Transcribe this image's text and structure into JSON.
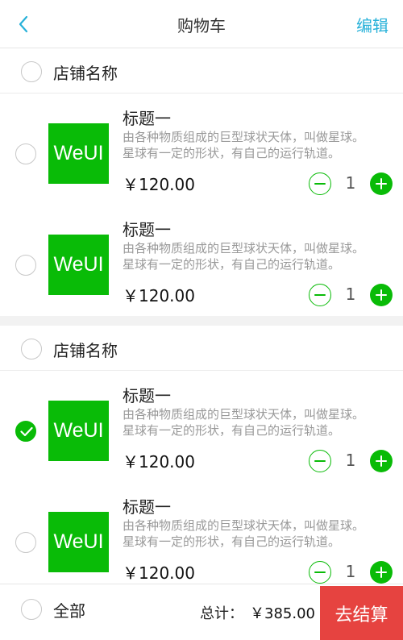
{
  "header": {
    "title": "购物车",
    "edit_label": "编辑",
    "back_icon": "chevron-left-icon"
  },
  "colors": {
    "accent_green": "#09bb07",
    "edit_blue": "#27b1d9",
    "checkout_red": "#e64340"
  },
  "stores": [
    {
      "name": "店铺名称",
      "checked": false,
      "items": [
        {
          "thumb_text": "WeUI",
          "title": "标题一",
          "desc_line1": "由各种物质组成的巨型球状天体，叫做星球。",
          "desc_line2": "星球有一定的形状，有自己的运行轨道。",
          "price": "￥120.00",
          "qty": "1",
          "checked": false
        },
        {
          "thumb_text": "WeUI",
          "title": "标题一",
          "desc_line1": "由各种物质组成的巨型球状天体，叫做星球。",
          "desc_line2": "星球有一定的形状，有自己的运行轨道。",
          "price": "￥120.00",
          "qty": "1",
          "checked": false
        }
      ]
    },
    {
      "name": "店铺名称",
      "checked": false,
      "items": [
        {
          "thumb_text": "WeUI",
          "title": "标题一",
          "desc_line1": "由各种物质组成的巨型球状天体，叫做星球。",
          "desc_line2": "星球有一定的形状，有自己的运行轨道。",
          "price": "￥120.00",
          "qty": "1",
          "checked": true
        },
        {
          "thumb_text": "WeUI",
          "title": "标题一",
          "desc_line1": "由各种物质组成的巨型球状天体，叫做星球。",
          "desc_line2": "星球有一定的形状，有自己的运行轨道。",
          "price": "￥120.00",
          "qty": "1",
          "checked": false
        }
      ]
    }
  ],
  "footer": {
    "select_all_label": "全部",
    "total_label": "总计：",
    "total_value": "￥385.00",
    "checkout_label": "去结算"
  }
}
